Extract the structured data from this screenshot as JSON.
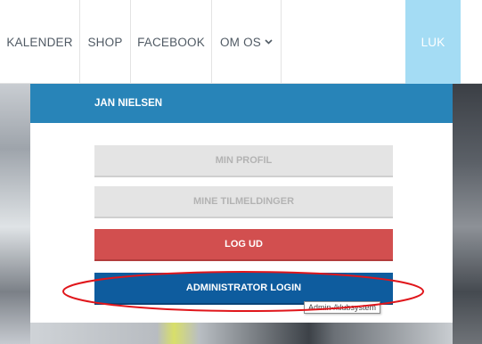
{
  "nav": {
    "items": [
      {
        "label": "KALENDER"
      },
      {
        "label": "SHOP"
      },
      {
        "label": "FACEBOOK"
      },
      {
        "label": "OM OS"
      }
    ],
    "om_os_chevron": "chevron-down-icon",
    "close_label": "LUK"
  },
  "panel": {
    "user_name": "JAN NIELSEN",
    "buttons": {
      "profile": "MIN PROFIL",
      "registrations": "MINE TILMELDINGER",
      "logout": "LOG UD",
      "admin": "ADMINISTRATOR LOGIN"
    }
  },
  "tooltip": {
    "text": "Admin-/klubsystem"
  },
  "colors": {
    "header_blue": "#2884b8",
    "close_bg": "#a4dcf4",
    "logout_red": "#d24f4f",
    "admin_blue": "#0e5c9e",
    "annotation_red": "#e0161b"
  }
}
